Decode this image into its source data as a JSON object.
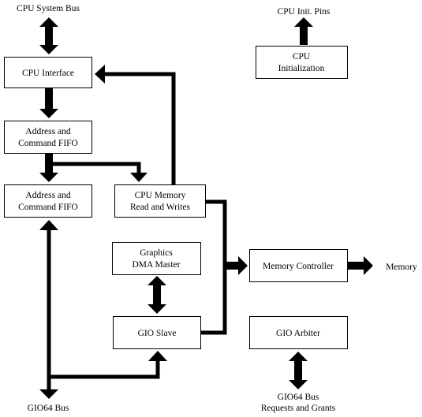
{
  "boxes": {
    "cpu_interface": [
      "CPU Interface"
    ],
    "addr_fifo_1": [
      "Address and",
      "Command FIFO"
    ],
    "addr_fifo_2": [
      "Address and",
      "Command FIFO"
    ],
    "cpu_memory": [
      "CPU Memory",
      "Read and Writes"
    ],
    "graphics_dma": [
      "Graphics",
      "DMA Master"
    ],
    "gio_slave": [
      "GIO Slave"
    ],
    "memory_controller": [
      "Memory Controller"
    ],
    "gio_arbiter": [
      "GIO Arbiter"
    ],
    "cpu_init": [
      "CPU",
      "Initialization"
    ]
  },
  "labels": {
    "cpu_system_bus": "CPU System Bus",
    "cpu_init_pins": "CPU Init. Pins",
    "memory": "Memory",
    "gio64_bus": "GIO64 Bus",
    "gio64_requests": [
      "GIO64 Bus",
      "Requests and Grants"
    ]
  }
}
